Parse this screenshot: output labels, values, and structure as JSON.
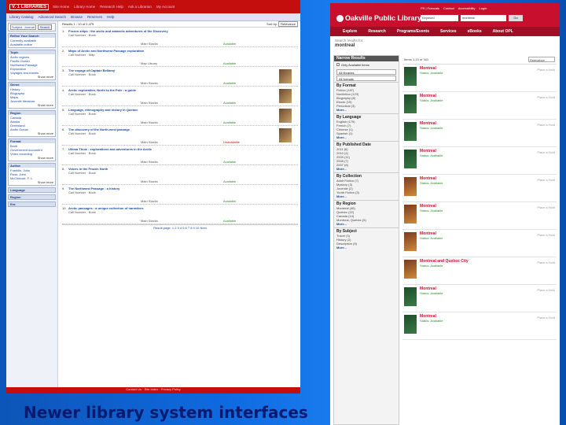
{
  "left": {
    "logo": "V. 1 LIBRARIES",
    "topnav": [
      "Site Home",
      "Library Home",
      "Research Help",
      "Ask a Librarian",
      "My Account"
    ],
    "tools": [
      "Library Catalog",
      "Advanced Search",
      "Browse",
      "Reserves",
      "Help"
    ],
    "search": {
      "select_value": "Subject, Journal",
      "button": "Search"
    },
    "sidebar": [
      {
        "title": "Refine Your Search",
        "items": [
          "Currently available",
          "Available online"
        ],
        "more": ""
      },
      {
        "title": "Topic",
        "items": [
          "Arctic regions",
          "Pacific Ocean",
          "Northwest Passage",
          "Exploration",
          "Voyages and travels"
        ],
        "more": "Show more"
      },
      {
        "title": "Genre",
        "items": [
          "History",
          "Biography",
          "Maps",
          "Juvenile literature"
        ],
        "more": "Show more"
      },
      {
        "title": "Region",
        "items": [
          "Canada",
          "Alaska",
          "Greenland",
          "Arctic Ocean"
        ],
        "more": "Show more"
      },
      {
        "title": "Format",
        "items": [
          "Book",
          "Government document",
          "Video recording"
        ],
        "more": "Show more"
      },
      {
        "title": "Author",
        "items": [
          "Franklin, John",
          "Ross, John",
          "McClintock, F. L."
        ],
        "more": "Show more"
      },
      {
        "title": "Language",
        "items": [],
        "more": ""
      },
      {
        "title": "Region",
        "items": [],
        "more": ""
      },
      {
        "title": "Era",
        "items": [],
        "more": ""
      }
    ],
    "result_bar": {
      "left": "Results 1 - 10 of 2,475",
      "sort_label": "Sort by:",
      "sort_value": "Relevance"
    },
    "results": [
      {
        "num": "1.",
        "title": "Frozen ships : the arctic and antarctic adventures of the Discovery",
        "meta": "Call Number · Book",
        "loc": "Main Stacks",
        "status": "Available",
        "cover": false
      },
      {
        "num": "2.",
        "title": "Maps of Arctic and Northwest Passage exploration",
        "meta": "Call Number · Map",
        "loc": "Map Library",
        "status": "Available",
        "cover": false
      },
      {
        "num": "3.",
        "title": "The voyage of Captain Bellamy",
        "meta": "Call Number · Book",
        "loc": "Main Stacks",
        "status": "Available",
        "cover": true
      },
      {
        "num": "4.",
        "title": "Arctic exploration, North to the Pole : a guide",
        "meta": "Call Number · Book",
        "loc": "Main Stacks",
        "status": "Available",
        "cover": true
      },
      {
        "num": "5.",
        "title": "Language, ethnography and history in Quebec",
        "meta": "Call Number · Book",
        "loc": "Main Stacks",
        "status": "Available",
        "cover": true
      },
      {
        "num": "6.",
        "title": "The discovery of the North-west passage",
        "meta": "Call Number · Book",
        "loc": "Main Stacks",
        "status": "Unavailable",
        "cover": true
      },
      {
        "num": "7.",
        "title": "Ultima Thule : explorations and adventures in the Arctic",
        "meta": "Call Number · Book",
        "loc": "Main Stacks",
        "status": "Available",
        "cover": false
      },
      {
        "num": "8.",
        "title": "Voices in the Frozen North",
        "meta": "Call Number · Book",
        "loc": "Main Stacks",
        "status": "Available",
        "cover": false
      },
      {
        "num": "9.",
        "title": "The Northwest Passage : a history",
        "meta": "Call Number · Book",
        "loc": "Main Stacks",
        "status": "Available",
        "cover": false
      },
      {
        "num": "10.",
        "title": "Arctic passages : a unique collection of narratives",
        "meta": "Call Number · Book",
        "loc": "Main Stacks",
        "status": "Available",
        "cover": false
      }
    ],
    "pager": "Result page: 1 2 3 4 5 6 7 8 9 10 Next",
    "footer": "Contact Us · Site Index · Privacy Policy"
  },
  "right": {
    "logo": "Oakville Public Library",
    "util": [
      "FR | Francais",
      "Contact",
      "Accessibility",
      "Login"
    ],
    "search": {
      "select_value": "Keyword",
      "input_value": "montreal",
      "button": "Go"
    },
    "nav": [
      "Explore",
      "Research",
      "Programs/Events",
      "Services",
      "eBooks",
      "About OPL"
    ],
    "crumb_label": "Search results for:",
    "crumb_query": "montreal",
    "facets": {
      "title": "Narrow Results",
      "top_check": "Only Available items",
      "selects": [
        "All libraries",
        "All formats"
      ],
      "sections": [
        {
          "title": "By Format",
          "items": [
            "Fiction (187)",
            "Nonfiction (123)",
            "Biography (8)",
            "Ebook (15)",
            "Periodical (3)"
          ],
          "more": "More..."
        },
        {
          "title": "By Language",
          "items": [
            "English (175)",
            "French (7)",
            "Chinese (1)",
            "Spanish (1)"
          ],
          "more": "More..."
        },
        {
          "title": "By Published Date",
          "items": [
            "2011 (6)",
            "2010 (4)",
            "2009 (11)",
            "2008 (7)",
            "2007 (8)"
          ],
          "more": "More..."
        },
        {
          "title": "By Collection",
          "items": [
            "Adult Fiction (7)",
            "Mystery (3)",
            "Juvenile (2)",
            "Youth Fiction (3)"
          ],
          "more": "More..."
        },
        {
          "title": "By Region",
          "items": [
            "Montreal (48)",
            "Quebec (22)",
            "Canada (14)",
            "Montreal, Quebec (5)"
          ],
          "more": "More..."
        },
        {
          "title": "By Subject",
          "items": [
            "Travel (3)",
            "History (2)",
            "Description (5)"
          ],
          "more": "More..."
        }
      ]
    },
    "result_bar": {
      "count": "Items 1-10 of 341",
      "sort_value": "Relevance"
    },
    "results": [
      {
        "title": "Montreal",
        "status": "Status: Available",
        "aside": "Place a Hold",
        "alt": false
      },
      {
        "title": "Montreal",
        "status": "Status: Available",
        "aside": "Place a Hold",
        "alt": false
      },
      {
        "title": "Montreal",
        "status": "Status: Available",
        "aside": "Place a Hold",
        "alt": false
      },
      {
        "title": "Montreal",
        "status": "Status: Available",
        "aside": "Place a Hold",
        "alt": false
      },
      {
        "title": "Montreal",
        "status": "Status: Available",
        "aside": "Place a Hold",
        "alt": true
      },
      {
        "title": "Montreal",
        "status": "Status: Available",
        "aside": "Place a Hold",
        "alt": true
      },
      {
        "title": "Montreal",
        "status": "Status: Available",
        "aside": "Place a Hold",
        "alt": true
      },
      {
        "title": "Montreal and Quebec City",
        "status": "Status: Available",
        "aside": "Place a Hold",
        "alt": true
      },
      {
        "title": "Montreal",
        "status": "Status: Available",
        "aside": "Place a Hold",
        "alt": false
      },
      {
        "title": "Montreal",
        "status": "Status: Available",
        "aside": "Place a Hold",
        "alt": false
      }
    ]
  },
  "caption": "Newer library system interfaces"
}
